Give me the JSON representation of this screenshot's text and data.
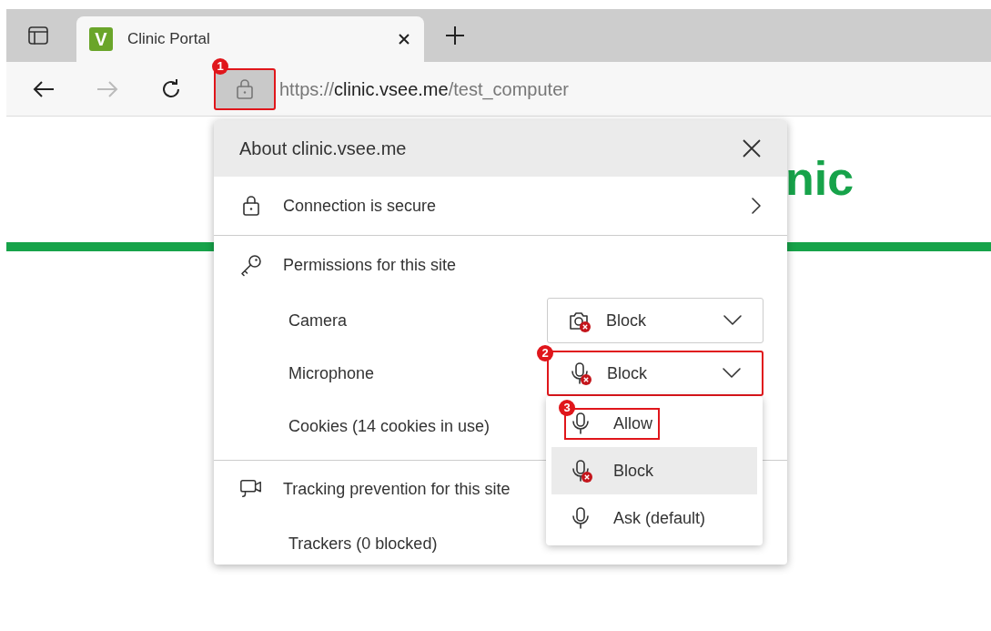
{
  "tab": {
    "favicon_letter": "V",
    "title": "Clinic Portal",
    "selected": true
  },
  "toolbar": {
    "forward_disabled": true,
    "site_info_callout": "1",
    "url": {
      "scheme": "https://",
      "host": "clinic.vsee.me",
      "path": "/test_computer"
    }
  },
  "page": {
    "logo_text": "nic"
  },
  "site_info": {
    "title": "About clinic.vsee.me",
    "connection": "Connection is secure",
    "permissions_heading": "Permissions for this site",
    "permissions": [
      {
        "kind": "camera",
        "label": "Camera",
        "value": "Block",
        "blocked": true,
        "expanded": false
      },
      {
        "kind": "microphone",
        "label": "Microphone",
        "value": "Block",
        "blocked": true,
        "expanded": true,
        "callout": "2",
        "options": [
          {
            "label": "Allow",
            "blocked": false,
            "selected": false,
            "callout": "3"
          },
          {
            "label": "Block",
            "blocked": true,
            "selected": true
          },
          {
            "label": "Ask (default)",
            "blocked": false,
            "selected": false
          }
        ]
      },
      {
        "kind": "text",
        "label": "Cookies (14 cookies in use)"
      }
    ],
    "tracking_heading": "Tracking prevention for this site",
    "trackers": "Trackers (0 blocked)"
  }
}
